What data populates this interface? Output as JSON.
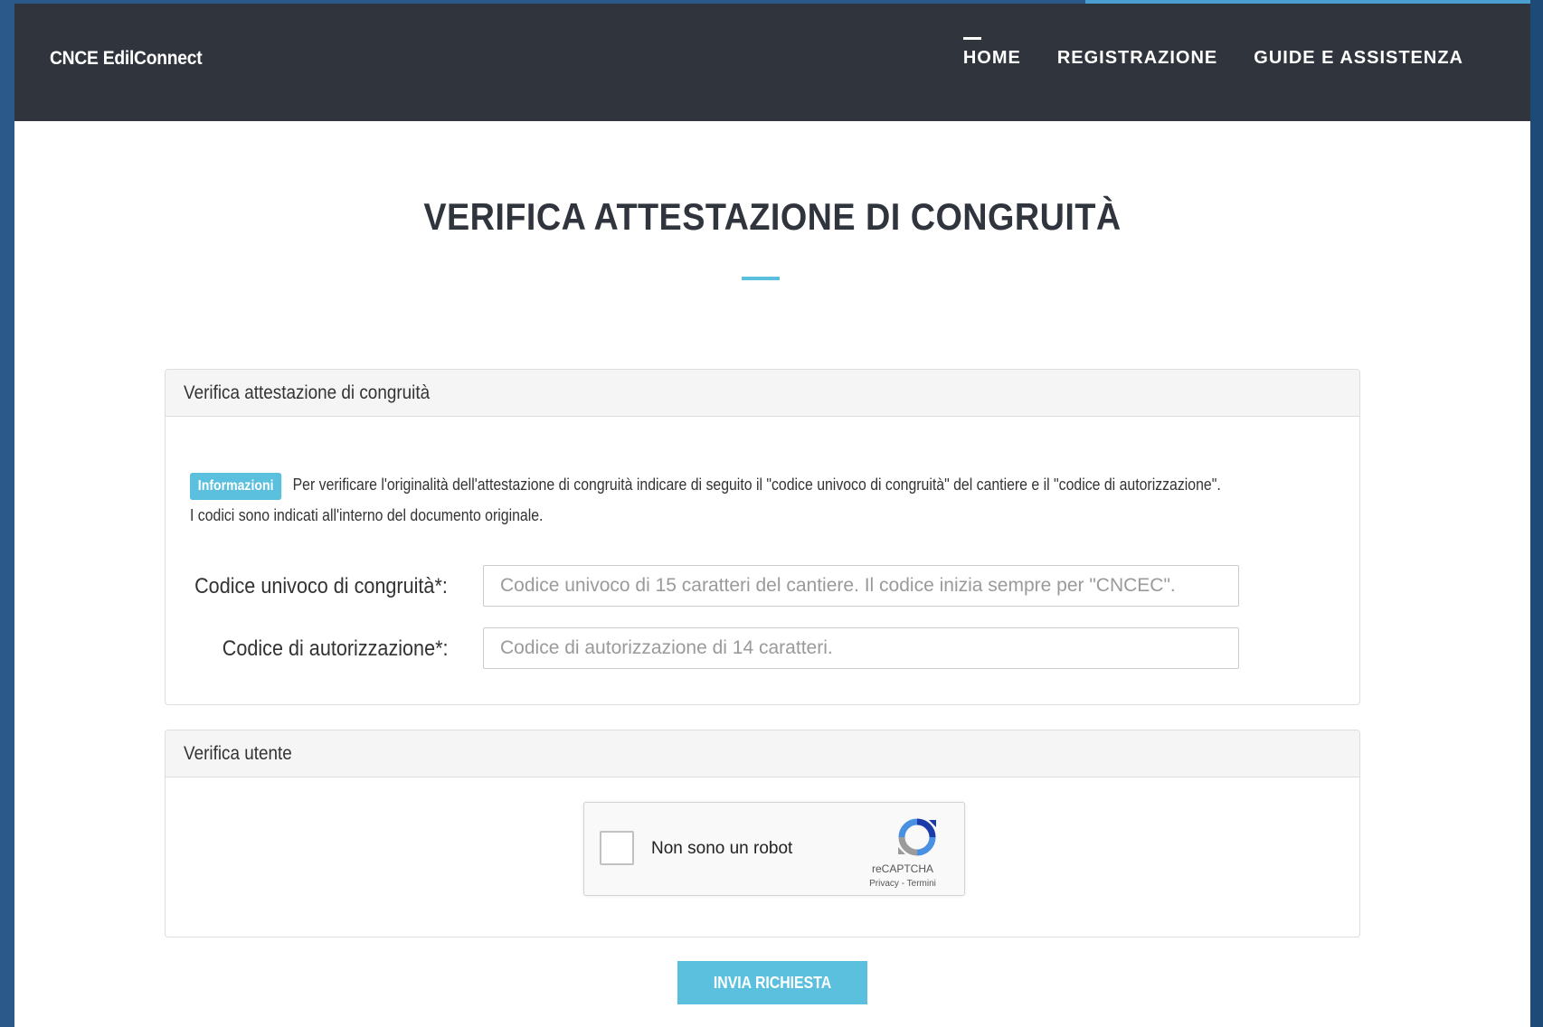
{
  "navbar": {
    "brand": "CNCE EdilConnect",
    "items": [
      {
        "label": "HOME",
        "active": true
      },
      {
        "label": "REGISTRAZIONE",
        "active": false
      },
      {
        "label": "GUIDE E ASSISTENZA",
        "active": false
      }
    ]
  },
  "main": {
    "title": "VERIFICA ATTESTAZIONE DI CONGRUITÀ"
  },
  "panel_verify": {
    "heading": "Verifica attestazione di congruità",
    "info_badge": "Informazioni",
    "info_text": "Per verificare l'originalità dell'attestazione di congruità indicare di seguito il \"codice univoco di congruità\" del cantiere e il \"codice di autorizzazione\".",
    "info_text_2": "I codici sono indicati all'interno del documento originale.",
    "fields": [
      {
        "label": "Codice univoco di congruità*:",
        "placeholder": "Codice univoco di 15 caratteri del cantiere. Il codice inizia sempre per \"CNCEC\".",
        "value": ""
      },
      {
        "label": "Codice di autorizzazione*:",
        "placeholder": "Codice di autorizzazione di 14 caratteri.",
        "value": ""
      }
    ]
  },
  "panel_user": {
    "heading": "Verifica utente",
    "captcha": {
      "label": "Non sono un robot",
      "brand": "reCAPTCHA",
      "links": "Privacy - Termini",
      "checked": false
    }
  },
  "submit_label": "INVIA RICHIESTA",
  "colors": {
    "navbar_bg": "#30353d",
    "accent": "#5bc0de",
    "title": "#30353d"
  }
}
